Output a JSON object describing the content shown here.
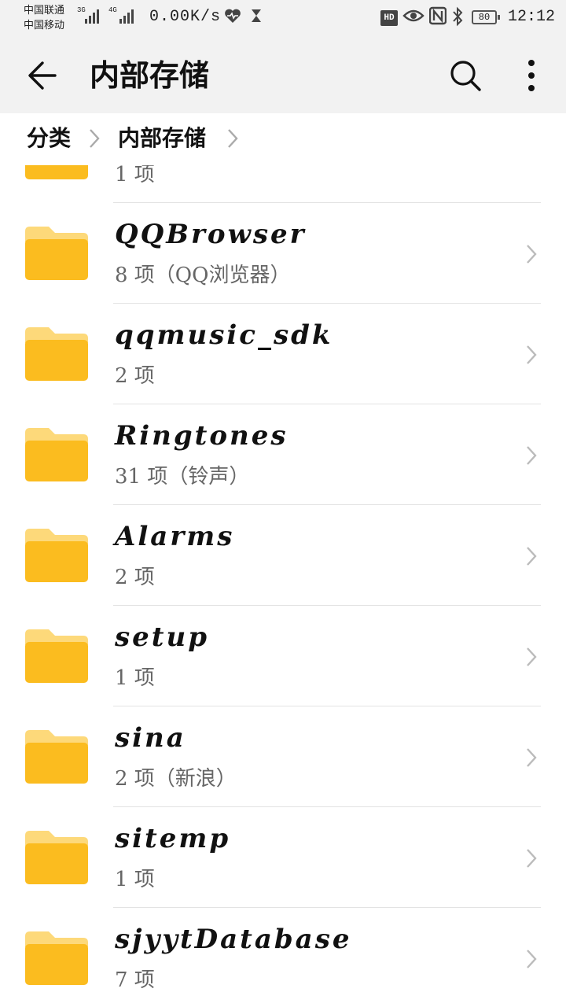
{
  "status_bar": {
    "carrier1": "中国联通",
    "carrier1_net": "3G",
    "carrier2": "中国移动",
    "carrier2_net": "4G",
    "speed": "0.00K/s",
    "battery": "80",
    "time": "12:12",
    "hd_label": "HD",
    "nfc_label": "N",
    "icons": [
      "heart-rate-icon",
      "hourglass-icon",
      "eye-icon",
      "nfc-icon",
      "bluetooth-icon"
    ]
  },
  "app_bar": {
    "title": "内部存储",
    "icons": [
      "back-arrow-icon",
      "search-icon",
      "more-vert-icon"
    ]
  },
  "breadcrumb": {
    "items": [
      "分类",
      "内部存储"
    ]
  },
  "colors": {
    "folder": "#FBBC1F",
    "folder_tab": "#FDD97A",
    "bar_bg": "#F2F2F2",
    "divider": "#E3E3E3",
    "meta_text": "#666666"
  },
  "folders": [
    {
      "name": "",
      "meta": "1 项"
    },
    {
      "name": "QQBrowser",
      "meta": "8 项（QQ浏览器）"
    },
    {
      "name": "qqmusic_sdk",
      "meta": "2 项"
    },
    {
      "name": "Ringtones",
      "meta": "31 项（铃声）"
    },
    {
      "name": "Alarms",
      "meta": "2 项"
    },
    {
      "name": "setup",
      "meta": "1 项"
    },
    {
      "name": "sina",
      "meta": "2 项（新浪）"
    },
    {
      "name": "sitemp",
      "meta": "1 项"
    },
    {
      "name": "sjyytDatabase",
      "meta": "7 项"
    }
  ]
}
